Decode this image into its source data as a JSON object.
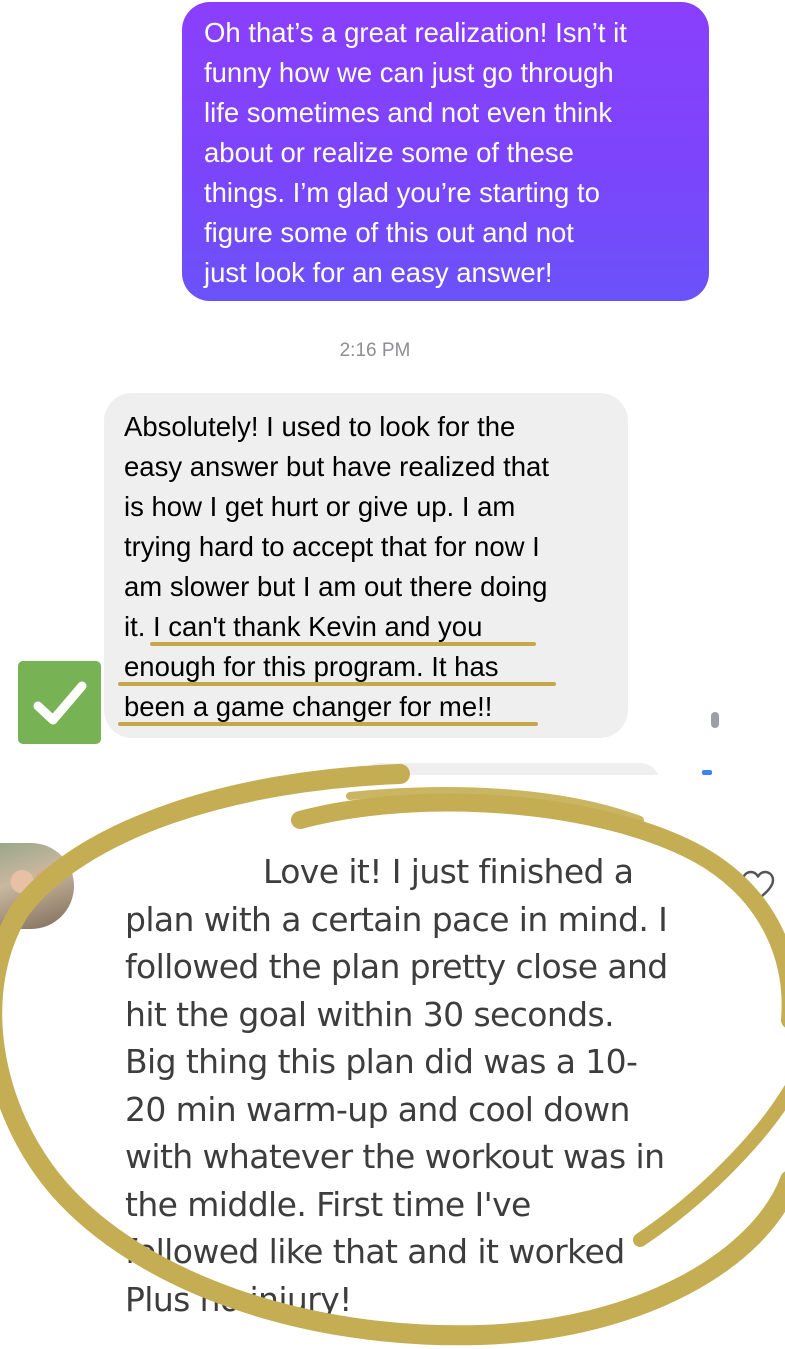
{
  "sent_message": {
    "lines": [
      "Oh that’s a great realization! Isn’t it",
      "funny how we can just go through",
      "life sometimes and not even think",
      "about or realize some of these",
      "things. I’m glad you’re starting to",
      "figure some of this out and not",
      "just look for an easy answer!"
    ]
  },
  "timestamp": "2:16 PM",
  "received_message": {
    "lines": [
      "Absolutely! I used to look for the",
      "easy answer but have realized that",
      "is how I get hurt or give up. I am",
      "trying hard to accept that for now I",
      "am slower but I am out there doing",
      "it. I can't thank Kevin and you",
      "enough for this program. It has",
      "been a game changer for me!!"
    ]
  },
  "checkmark_icon": "white-check-mark-icon",
  "checkmark_color": "#77b255",
  "highlight_color": "#c4a84a",
  "sent_bubble_color": "#7c45fb",
  "comment": {
    "lines": [
      "Love it! I just finished a",
      "plan with a certain pace in mind. I",
      "followed the plan pretty close and",
      "hit the goal within 30 seconds.",
      "Big thing this plan did was a 10-",
      "20 min warm-up and cool down",
      "with whatever the workout was in",
      "the middle. First time I've",
      "followed like that and it worked",
      "Plus no injury!"
    ],
    "like_icon": "heart-outline-icon"
  }
}
